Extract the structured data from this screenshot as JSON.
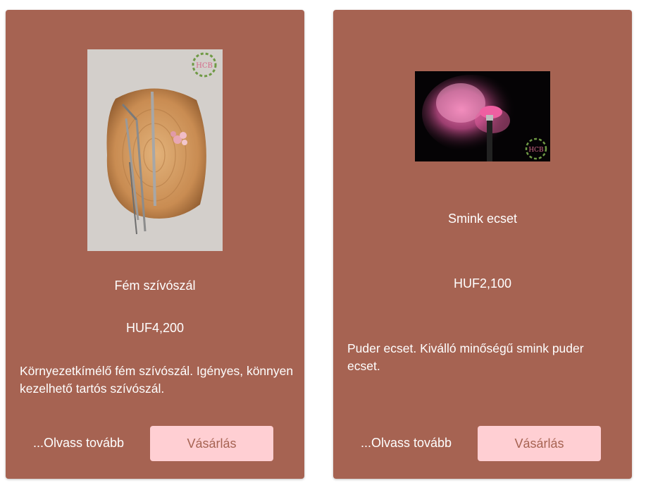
{
  "products": [
    {
      "name": "Fém szívószál",
      "price": "HUF4,200",
      "description": "Környezetkímélő fém szívószál. Igényes, könnyen kezelhető tartós szívószál.",
      "read_more_label": "...Olvass tovább",
      "buy_label": "Vásárlás",
      "image_name": "metal-straws-photo",
      "logo_text": "HCB"
    },
    {
      "name": "Smink ecset",
      "price": "HUF2,100",
      "description": "Puder ecset. Kiválló minőségű smink puder ecset.",
      "read_more_label": "...Olvass tovább",
      "buy_label": "Vásárlás",
      "image_name": "makeup-brush-photo",
      "logo_text": "HCB"
    }
  ],
  "colors": {
    "card_background": "#a66352",
    "button_background": "#ffcfd3",
    "button_text": "#a66352",
    "text": "#ffffff"
  }
}
